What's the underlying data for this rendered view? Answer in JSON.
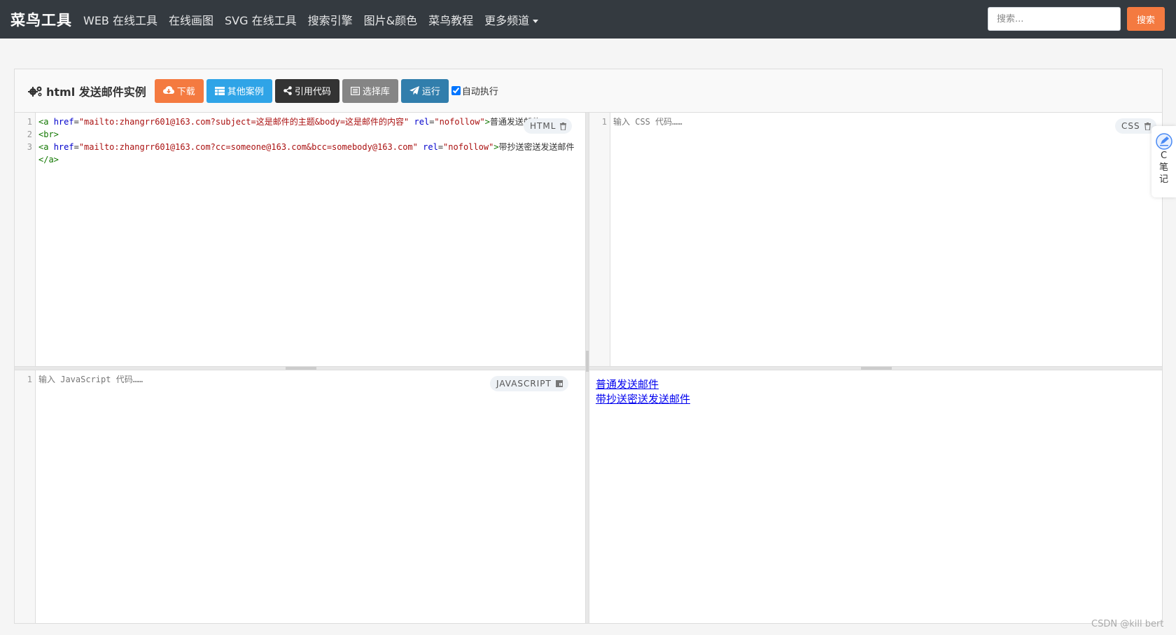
{
  "navbar": {
    "brand": "菜鸟工具",
    "items": [
      "WEB 在线工具",
      "在线画图",
      "SVG 在线工具",
      "搜索引擎",
      "图片&颜色",
      "菜鸟教程",
      "更多频道"
    ],
    "search_placeholder": "搜索...",
    "search_button": "搜索"
  },
  "panel": {
    "title": "html 发送邮件实例",
    "buttons": {
      "download": "下载",
      "other_examples": "其他案例",
      "cite_code": "引用代码",
      "select_library": "选择库",
      "run": "运行"
    },
    "autorun_label": "自动执行",
    "autorun_checked": true
  },
  "html_editor": {
    "badge": "HTML",
    "line_numbers": [
      "1",
      "2",
      "3"
    ],
    "lines": [
      [
        {
          "t": "tag",
          "v": "<a "
        },
        {
          "t": "attr",
          "v": "href"
        },
        {
          "t": "text",
          "v": "="
        },
        {
          "t": "str",
          "v": "\"mailto:zhangrr601@163.com?subject=这是邮件的主题&body=这是邮件的内容\""
        },
        {
          "t": "text",
          "v": " "
        },
        {
          "t": "attr",
          "v": "rel"
        },
        {
          "t": "text",
          "v": "="
        },
        {
          "t": "str",
          "v": "\"nofollow\""
        },
        {
          "t": "tag",
          "v": ">"
        },
        {
          "t": "text",
          "v": "普通发送邮件"
        },
        {
          "t": "tag",
          "v": "</a>"
        }
      ],
      [
        {
          "t": "tag",
          "v": "<br>"
        }
      ],
      [
        {
          "t": "tag",
          "v": "<a "
        },
        {
          "t": "attr",
          "v": "href"
        },
        {
          "t": "text",
          "v": "="
        },
        {
          "t": "str",
          "v": "\"mailto:zhangrr601@163.com?cc=someone@163.com&bcc=somebody@163.com\""
        },
        {
          "t": "text",
          "v": " "
        },
        {
          "t": "attr",
          "v": "rel"
        },
        {
          "t": "text",
          "v": "="
        },
        {
          "t": "str",
          "v": "\"nofollow\""
        },
        {
          "t": "tag",
          "v": ">"
        },
        {
          "t": "text",
          "v": "带抄送密送发送邮件"
        }
      ],
      [
        {
          "t": "tag",
          "v": "</a>"
        }
      ]
    ]
  },
  "css_editor": {
    "badge": "CSS",
    "line_numbers": [
      "1"
    ],
    "placeholder": "输入 CSS 代码……"
  },
  "js_editor": {
    "badge": "JAVASCRIPT",
    "line_numbers": [
      "1"
    ],
    "placeholder": "输入 JavaScript 代码……"
  },
  "result": {
    "links": [
      "普通发送邮件",
      "带抄送密送发送邮件"
    ]
  },
  "note_widget": {
    "label": "C笔记"
  },
  "watermark": "CSDN @kill bert",
  "colors": {
    "navbar": "#343a40",
    "orange": "#f47a40",
    "blue": "#2fa4e7",
    "dark": "#333333",
    "gray": "#858585",
    "navy": "#317eac",
    "link": "#0000ee"
  }
}
